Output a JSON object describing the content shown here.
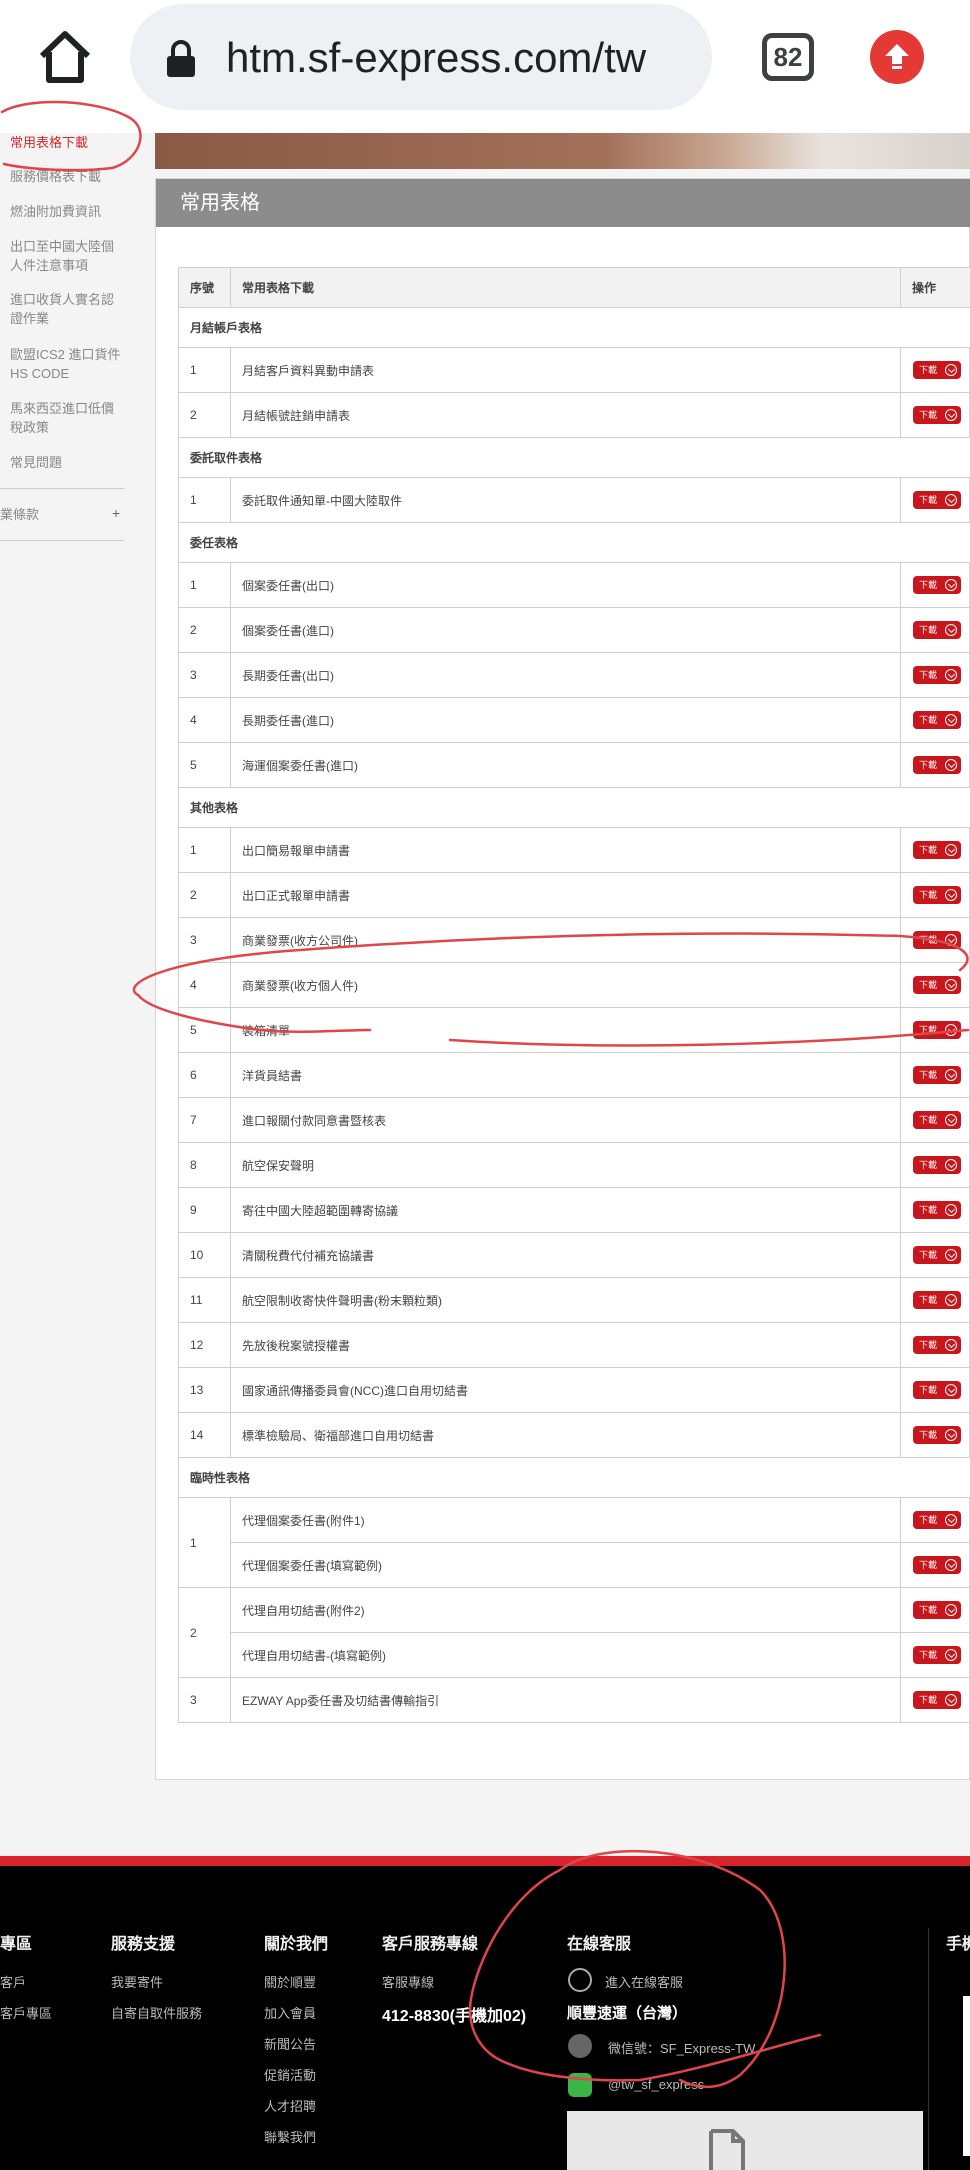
{
  "browser": {
    "url": "htm.sf-express.com/tw",
    "tab_count": "82"
  },
  "sidebar": {
    "items": [
      {
        "label": "常用表格下載"
      },
      {
        "label": "服務價格表下載"
      },
      {
        "label": "燃油附加費資訊"
      },
      {
        "label": "出口至中國大陸個人件注意事項"
      },
      {
        "label": "進口收貨人實名認證作業"
      },
      {
        "label": "歐盟ICS2 進口貨件HS CODE"
      },
      {
        "label": "馬來西亞進口低價稅政策"
      },
      {
        "label": "常見問題"
      }
    ],
    "collapsible": {
      "label": "業條款",
      "toggle": "+"
    }
  },
  "panel": {
    "title": "常用表格",
    "table": {
      "headers": {
        "num": "序號",
        "name": "常用表格下載",
        "op": "操作"
      },
      "download_label": "下載",
      "sections": [
        {
          "title": "月結帳戶表格",
          "rows": [
            {
              "num": "1",
              "name": "月結客戶資料異動申請表"
            },
            {
              "num": "2",
              "name": "月結帳號註銷申請表"
            }
          ]
        },
        {
          "title": "委託取件表格",
          "rows": [
            {
              "num": "1",
              "name": "委託取件通知單-中國大陸取件"
            }
          ]
        },
        {
          "title": "委任表格",
          "rows": [
            {
              "num": "1",
              "name": "個案委任書(出口)"
            },
            {
              "num": "2",
              "name": "個案委任書(進口)"
            },
            {
              "num": "3",
              "name": "長期委任書(出口)"
            },
            {
              "num": "4",
              "name": "長期委任書(進口)"
            },
            {
              "num": "5",
              "name": "海運個案委任書(進口)"
            }
          ]
        },
        {
          "title": "其他表格",
          "rows": [
            {
              "num": "1",
              "name": "出口簡易報單申請書"
            },
            {
              "num": "2",
              "name": "出口正式報單申請書"
            },
            {
              "num": "3",
              "name": "商業發票(收方公司件)"
            },
            {
              "num": "4",
              "name": "商業發票(收方個人件)"
            },
            {
              "num": "5",
              "name": "裝箱清單"
            },
            {
              "num": "6",
              "name": "洋貨員結書"
            },
            {
              "num": "7",
              "name": "進口報關付款同意書暨核表"
            },
            {
              "num": "8",
              "name": "航空保安聲明"
            },
            {
              "num": "9",
              "name": "寄往中國大陸超範圍轉寄協議"
            },
            {
              "num": "10",
              "name": "清關稅費代付補充協議書"
            },
            {
              "num": "11",
              "name": "航空限制收寄快件聲明書(粉末顆粒類)"
            },
            {
              "num": "12",
              "name": "先放後稅案號授權書"
            },
            {
              "num": "13",
              "name": "國家通訊傳播委員會(NCC)進口自用切結書"
            },
            {
              "num": "14",
              "name": "標準檢驗局、衛福部進口自用切結書"
            }
          ]
        },
        {
          "title": "臨時性表格",
          "groups": [
            {
              "num": "1",
              "items": [
                "代理個案委任書(附件1)",
                "代理個案委任書(填寫範例)"
              ]
            },
            {
              "num": "2",
              "items": [
                "代理自用切結書(附件2)",
                "代理自用切結書-(填寫範例)"
              ]
            },
            {
              "num": "3",
              "items": [
                "EZWAY App委任書及切結書傳輸指引"
              ]
            }
          ]
        }
      ]
    }
  },
  "footer": {
    "col1": {
      "title": "專區",
      "links": [
        "客戶",
        "客戶專區"
      ]
    },
    "col2": {
      "title": "服務支援",
      "links": [
        "我要寄件",
        "自寄自取件服務"
      ]
    },
    "col3": {
      "title": "關於我們",
      "links": [
        "關於順豐",
        "加入會員",
        "新聞公告",
        "促銷活動",
        "人才招聘",
        "聯繫我們"
      ]
    },
    "col4": {
      "title": "客戶服務專線",
      "label": "客服專線",
      "phone": "412-8830(手機加02)"
    },
    "col5": {
      "title": "在線客服",
      "chat": "進入在線客服",
      "company": "順豐速運（台灣）",
      "wechat": "微信號：SF_Express-TW",
      "line": "@tw_sf_express"
    },
    "col6": {
      "title": "手機"
    }
  },
  "colors": {
    "brand_red": "#c8161d",
    "header_gray": "#8c8c8c",
    "annotation_red": "#e0454a"
  }
}
